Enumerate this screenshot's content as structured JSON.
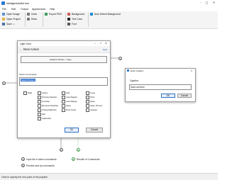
{
  "window": {
    "title": "IntelligentAsBot.Inst"
  },
  "menu": [
    "File",
    "Edit",
    "Output",
    "Appearance",
    "Help"
  ],
  "toolbar": {
    "open_image": "Open Image",
    "open_project": "Open Project",
    "save": "Save",
    "undo": "Undo",
    "redo": "Redo",
    "export_png": "Export PNG",
    "background": "Background",
    "text_color": "Text Color",
    "font": "Font",
    "auto_detect": "Auto Detect Background"
  },
  "light_color_dialog": {
    "title": "Light Color",
    "header": "New Action",
    "help_link": "Help",
    "preview_text": "Capture Screen - Copy",
    "action_commands_label": "Action Commands",
    "action_commands_value": "Select Screen",
    "checkboxes_col1": [
      "Wait",
      "Primary Monitor",
      "Concise",
      "Remove Desktop",
      "Virtual Machine",
      "File",
      "Clipboard"
    ],
    "checkboxes_col2": [
      "Full",
      "Last Region",
      "Last Range",
      "Save",
      "Print Color",
      "",
      ""
    ],
    "checkboxes_col3": [
      "Copy",
      "Print",
      "Save",
      "Save (Timer)",
      "Upload",
      "",
      ""
    ],
    "ok_label": "OK",
    "cancel_label": "Cancel"
  },
  "caption_dialog": {
    "title": "Enter Caption",
    "label": "Caption:",
    "value": "Save and text",
    "ok_label": "OK",
    "cancel_label": "Cancel"
  },
  "callouts": [
    {
      "num": "1",
      "text": ""
    },
    {
      "num": "2",
      "text": ""
    },
    {
      "num": "3",
      "text": "Input list of action commands"
    },
    {
      "num": "4",
      "text": "Results of Commands"
    },
    {
      "num": "5",
      "text": "Preview and try commands"
    }
  ],
  "status_text": "Click to specify the end point of the polyline"
}
